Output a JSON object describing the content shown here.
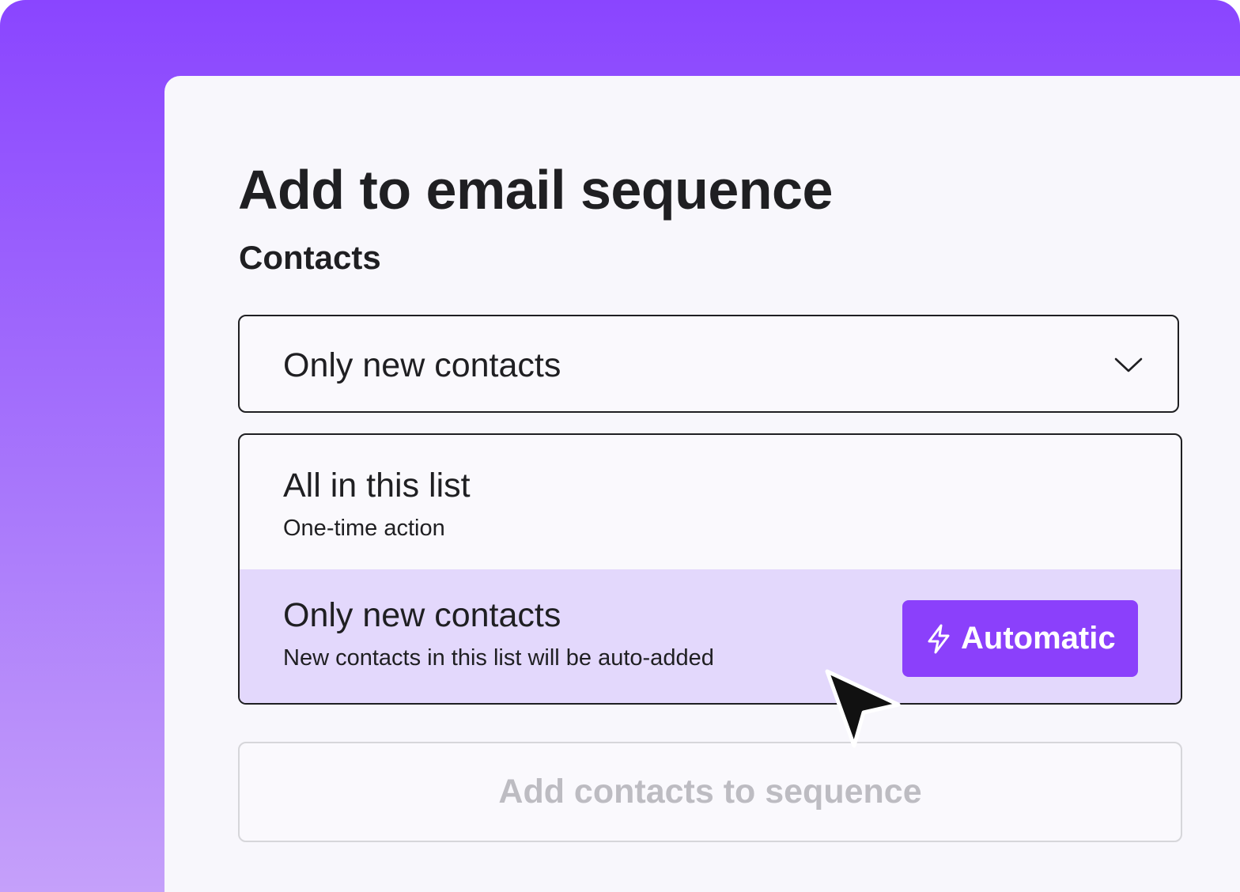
{
  "dialog": {
    "title": "Add to email sequence",
    "section_label": "Contacts"
  },
  "select": {
    "value": "Only new contacts",
    "icon": "chevron-down-icon"
  },
  "options": [
    {
      "title": "All in this list",
      "subtitle": "One-time action",
      "highlighted": false
    },
    {
      "title": "Only new contacts",
      "subtitle": "New contacts in this list will be auto-added",
      "highlighted": true,
      "badge": {
        "icon": "lightning-bolt-icon",
        "label": "Automatic"
      }
    }
  ],
  "actions": {
    "add_label": "Add contacts to sequence"
  },
  "colors": {
    "accent": "#8b40fb",
    "highlight": "#e3d8fc",
    "text": "#1f1f22",
    "disabled_text": "#bdbcc2"
  },
  "pointer": {
    "icon": "mouse-cursor-icon"
  }
}
